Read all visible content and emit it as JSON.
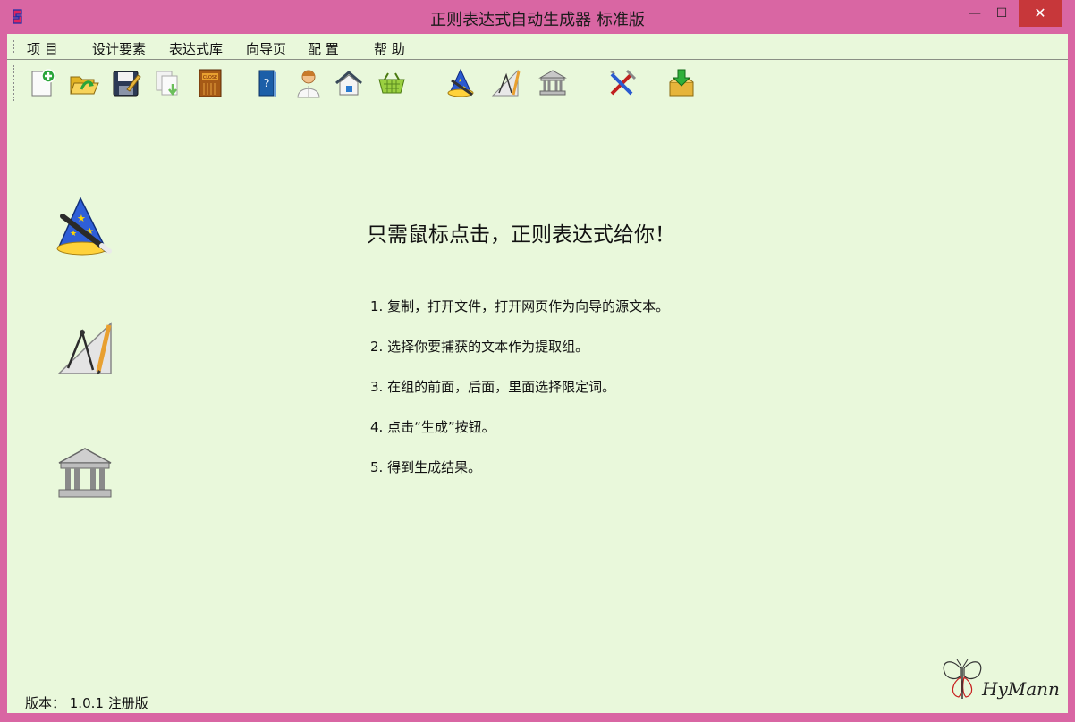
{
  "window": {
    "title": "正则表达式自动生成器 标准版",
    "app_icon": "app-logo-icon",
    "controls": {
      "minimize": "—",
      "maximize": "☐",
      "close": "✕"
    }
  },
  "menu": [
    "项 目",
    "设计要素",
    "表达式库",
    "向导页",
    "配 置",
    "帮 助"
  ],
  "toolbar": [
    {
      "name": "new-file-icon"
    },
    {
      "name": "open-folder-icon"
    },
    {
      "name": "save-disk-icon"
    },
    {
      "name": "copy-pages-icon"
    },
    {
      "name": "close-door-icon"
    },
    {
      "name": "help-book-icon"
    },
    {
      "name": "user-doctor-icon"
    },
    {
      "name": "home-icon"
    },
    {
      "name": "basket-icon"
    },
    {
      "name": "wizard-hat-icon"
    },
    {
      "name": "compass-ruler-icon"
    },
    {
      "name": "library-building-icon"
    },
    {
      "name": "tools-icon"
    },
    {
      "name": "download-box-icon"
    }
  ],
  "main": {
    "heading": "只需鼠标点击，正则表达式给你！",
    "steps": [
      "1. 复制，打开文件，打开网页作为向导的源文本。",
      "2. 选择你要捕获的文本作为提取组。",
      "3. 在组的前面，后面，里面选择限定词。",
      "4. 点击“生成”按钮。",
      "5. 得到生成结果。"
    ],
    "side_icons": [
      "wizard-hat-icon",
      "compass-ruler-icon",
      "library-building-icon"
    ]
  },
  "footer": {
    "version": "版本：  1.0.1  注册版",
    "logo_text": "HyMann"
  }
}
